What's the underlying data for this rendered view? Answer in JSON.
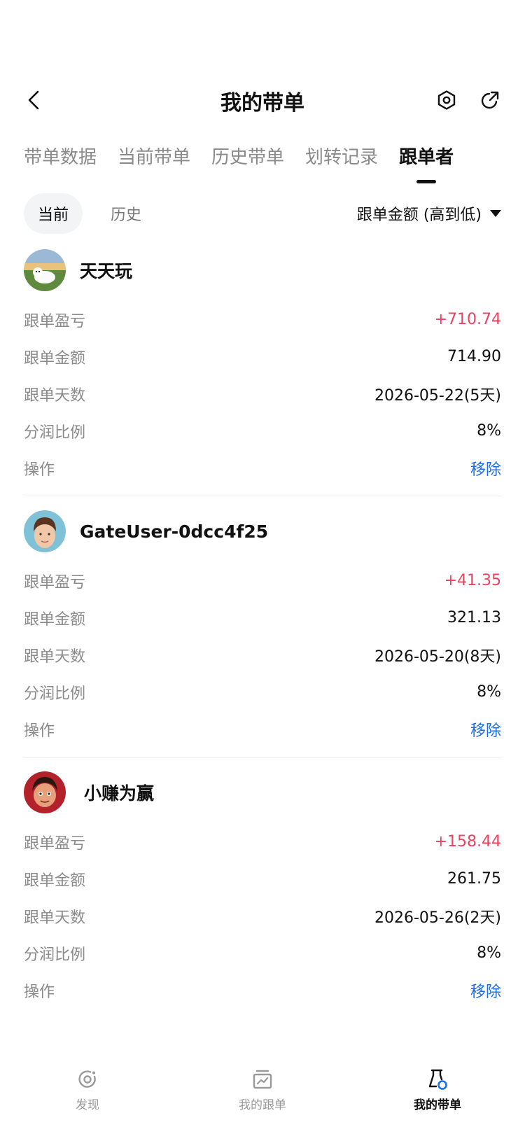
{
  "header": {
    "title": "我的带单"
  },
  "tabs": [
    {
      "label": "带单数据"
    },
    {
      "label": "当前带单"
    },
    {
      "label": "历史带单"
    },
    {
      "label": "划转记录"
    },
    {
      "label": "跟单者"
    }
  ],
  "subfilter": {
    "current": "当前",
    "history": "历史",
    "sort_label": "跟单金额 (高到低)"
  },
  "followers": [
    {
      "name": "天天玩",
      "rows": [
        {
          "label": "跟单盈亏",
          "value": "+710.74"
        },
        {
          "label": "跟单金额",
          "value": "714.90"
        },
        {
          "label": "跟单天数",
          "value": "2026-05-22(5天)"
        },
        {
          "label": "分润比例",
          "value": "8%"
        },
        {
          "label": "操作",
          "value": "移除"
        }
      ]
    },
    {
      "name": "GateUser-0dcc4f25",
      "rows": [
        {
          "label": "跟单盈亏",
          "value": "+41.35"
        },
        {
          "label": "跟单金额",
          "value": "321.13"
        },
        {
          "label": "跟单天数",
          "value": "2026-05-20(8天)"
        },
        {
          "label": "分润比例",
          "value": "8%"
        },
        {
          "label": "操作",
          "value": "移除"
        }
      ]
    },
    {
      "name": "小赚为赢",
      "rows": [
        {
          "label": "跟单盈亏",
          "value": "+158.44"
        },
        {
          "label": "跟单金额",
          "value": "261.75"
        },
        {
          "label": "跟单天数",
          "value": "2026-05-26(2天)"
        },
        {
          "label": "分润比例",
          "value": "8%"
        },
        {
          "label": "操作",
          "value": "移除"
        }
      ]
    }
  ],
  "bottom_nav": [
    {
      "label": "发现",
      "icon": "discover-icon"
    },
    {
      "label": "我的跟单",
      "icon": "copy-trade-icon"
    },
    {
      "label": "我的带单",
      "icon": "lead-trade-icon"
    }
  ],
  "colors": {
    "profit": "#f0405f",
    "action": "#1a6fe8",
    "label": "#8a8a8a"
  }
}
